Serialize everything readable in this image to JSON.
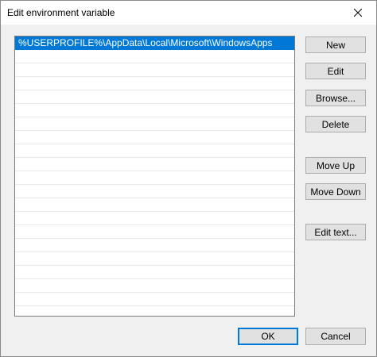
{
  "window": {
    "title": "Edit environment variable"
  },
  "icons": {
    "close": "close-icon"
  },
  "list": {
    "items": [
      "%USERPROFILE%\\AppData\\Local\\Microsoft\\WindowsApps"
    ],
    "selected_index": 0
  },
  "side_buttons": {
    "new": "New",
    "edit": "Edit",
    "browse": "Browse...",
    "delete": "Delete",
    "move_up": "Move Up",
    "move_down": "Move Down",
    "edit_text": "Edit text..."
  },
  "footer": {
    "ok": "OK",
    "cancel": "Cancel"
  },
  "colors": {
    "selection": "#0078d7",
    "button_face": "#e1e1e1",
    "dialog_bg": "#f0f0f0"
  }
}
